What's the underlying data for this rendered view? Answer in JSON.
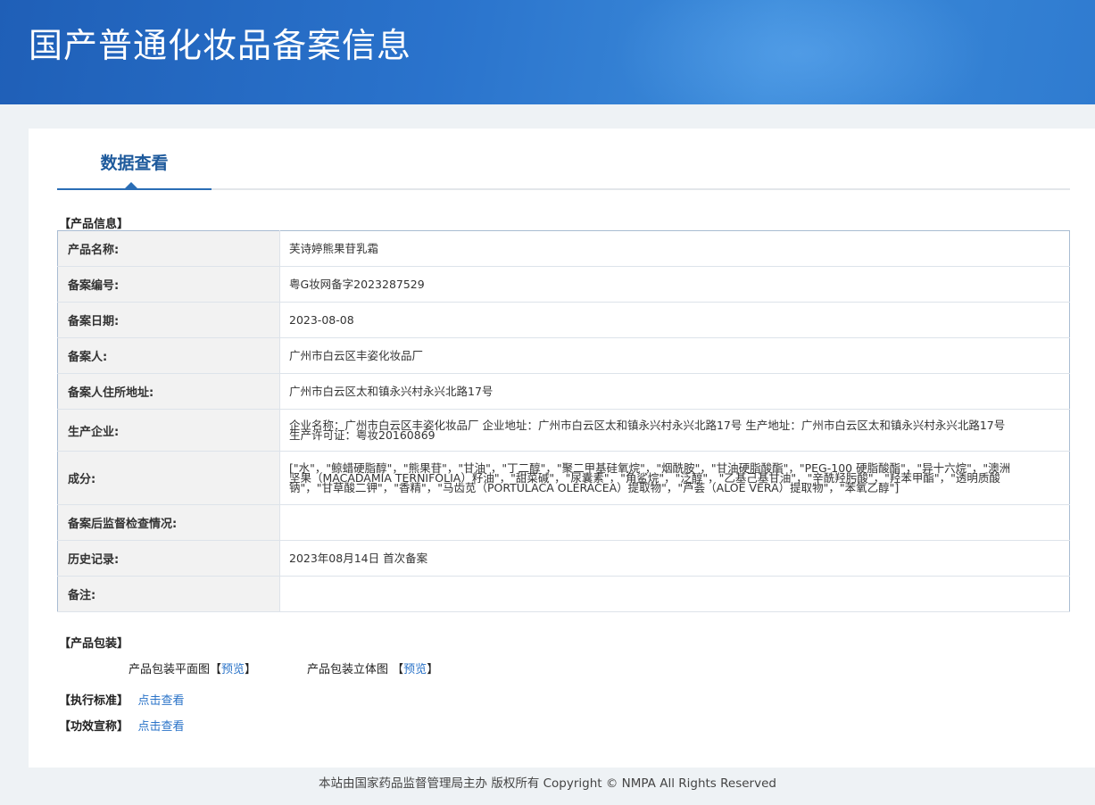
{
  "header": {
    "title": "国产普通化妆品备案信息"
  },
  "tab": {
    "label": "数据查看"
  },
  "sections": {
    "product_info": "【产品信息】",
    "packaging": "【产品包装】",
    "standard": "【执行标准】",
    "efficacy": "【功效宣称】"
  },
  "product_info": {
    "rows": [
      {
        "label": "产品名称:",
        "value": "芙诗婷熊果苷乳霜"
      },
      {
        "label": "备案编号:",
        "value": "粤G妆网备字2023287529"
      },
      {
        "label": "备案日期:",
        "value": "2023-08-08"
      },
      {
        "label": "备案人:",
        "value": "广州市白云区丰姿化妆品厂"
      },
      {
        "label": "备案人住所地址:",
        "value": "广州市白云区太和镇永兴村永兴北路17号"
      },
      {
        "label": "生产企业:",
        "value": "企业名称：广州市白云区丰姿化妆品厂 企业地址：广州市白云区太和镇永兴村永兴北路17号 生产地址：广州市白云区太和镇永兴村永兴北路17号 生产许可证：粤妆20160869"
      },
      {
        "label": "成分:",
        "value": "[\"水\"，\"鲸蜡硬脂醇\"，\"熊果苷\"，\"甘油\"，\"丁二醇\"，\"聚二甲基硅氧烷\"，\"烟酰胺\"，\"甘油硬脂酸酯\"，\"PEG-100 硬脂酸酯\"，\"异十六烷\"，\"澳洲坚果（MACADAMIA TERNIFOLIA）籽油\"，\"甜菜碱\"，\"尿囊素\"，\"角鲨烷\"，\"泛醇\"，\"乙基己基甘油\"，\"辛酰羟肟酸\"，\"羟苯甲酯\"，\"透明质酸钠\"，\"甘草酸二钾\"，\"香精\"，\"马齿苋（PORTULACA OLERACEA）提取物\"，\"芦荟（ALOE VERA）提取物\"，\"苯氧乙醇\"]"
      },
      {
        "label": "备案后监督检查情况:",
        "value": ""
      },
      {
        "label": "历史记录:",
        "value": "2023年08月14日 首次备案"
      },
      {
        "label": "备注:",
        "value": ""
      }
    ]
  },
  "packaging": {
    "flat_label": "产品包装平面图",
    "flat_link": "预览",
    "solid_label": "产品包装立体图",
    "solid_link": "预览",
    "bracket_open": "【",
    "bracket_close": "】"
  },
  "standard": {
    "link": "点击查看"
  },
  "efficacy": {
    "link": "点击查看"
  },
  "footer": {
    "text": "本站由国家药品监督管理局主办 版权所有 Copyright © NMPA All Rights Reserved"
  }
}
